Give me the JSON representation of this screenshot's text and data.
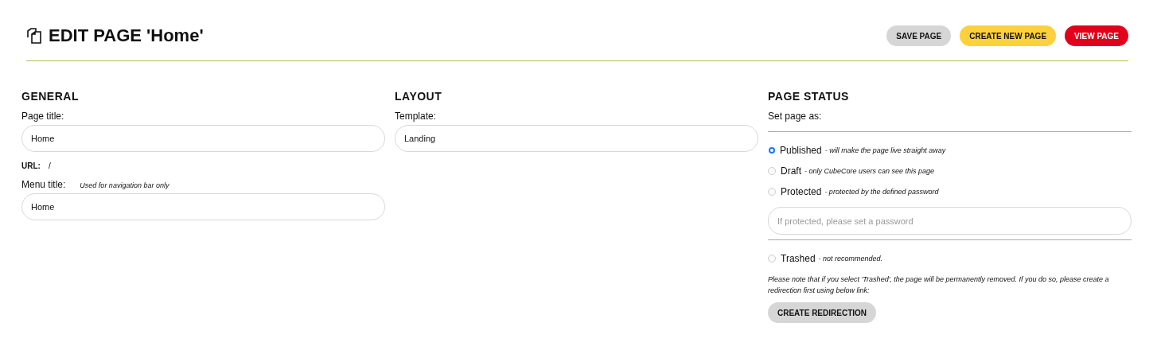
{
  "header": {
    "title": "EDIT PAGE 'Home'",
    "buttons": [
      {
        "label": "SAVE PAGE",
        "color": "#d6d6d6"
      },
      {
        "label": "CREATE NEW PAGE",
        "color": "#fdd13b"
      },
      {
        "label": "VIEW PAGE",
        "color": "#e2001a"
      }
    ]
  },
  "general": {
    "heading": "GENERAL",
    "page_title": {
      "label": "Page title:",
      "value": "Home"
    },
    "url": {
      "label": "URL:",
      "value": "/"
    },
    "menu_title": {
      "label": "Menu title:",
      "hint": "Used for navigation bar only",
      "value": "Home"
    }
  },
  "layout": {
    "heading": "LAYOUT",
    "template": {
      "label": "Template:",
      "value": "Landing"
    }
  },
  "page_status": {
    "heading": "PAGE STATUS",
    "label": "Set page as:",
    "options": [
      {
        "label": "Published",
        "note": "- will make the page live straight away",
        "selected": true
      },
      {
        "label": "Draft",
        "note": "- only CubeCore users can see this page",
        "selected": false
      },
      {
        "label": "Protected",
        "note": "- protected by the defined password",
        "selected": false
      }
    ],
    "password": {
      "placeholder": "If protected, please set a password"
    },
    "trash_option": {
      "label": "Trashed",
      "note": "- not recommended.",
      "selected": false
    },
    "notice": "Please note that if you select 'Trashed', the page will be permanently removed. If you do so, please create a redirection first using below link:",
    "button": "CREATE REDIRECTION"
  }
}
